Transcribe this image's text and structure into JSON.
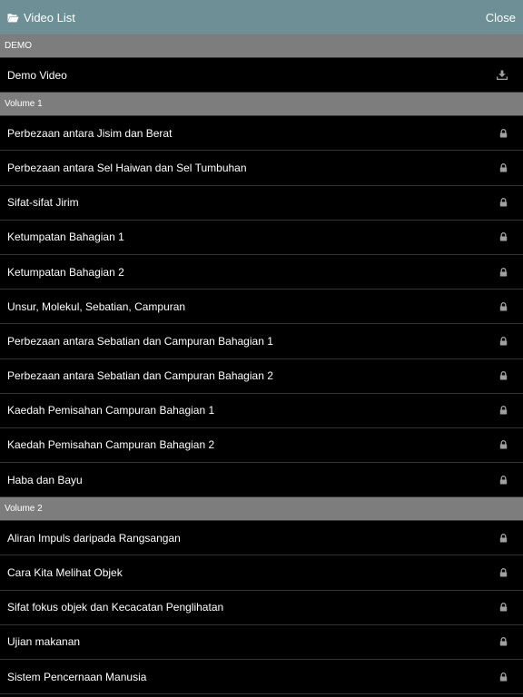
{
  "header": {
    "title": "Video List",
    "title_icon": "folder-open-icon",
    "close_label": "Close"
  },
  "sections": [
    {
      "label": "DEMO",
      "items": [
        {
          "label": "Demo Video",
          "icon": "download-icon"
        }
      ]
    },
    {
      "label": "Volume 1",
      "items": [
        {
          "label": "Perbezaan antara Jisim dan Berat",
          "icon": "lock-icon"
        },
        {
          "label": "Perbezaan antara Sel Haiwan dan Sel Tumbuhan",
          "icon": "lock-icon"
        },
        {
          "label": "Sifat-sifat Jirim",
          "icon": "lock-icon"
        },
        {
          "label": "Ketumpatan Bahagian 1",
          "icon": "lock-icon"
        },
        {
          "label": "Ketumpatan Bahagian 2",
          "icon": "lock-icon"
        },
        {
          "label": "Unsur, Molekul, Sebatian, Campuran",
          "icon": "lock-icon"
        },
        {
          "label": "Perbezaan antara Sebatian dan Campuran Bahagian 1",
          "icon": "lock-icon"
        },
        {
          "label": "Perbezaan antara Sebatian dan Campuran Bahagian 2",
          "icon": "lock-icon"
        },
        {
          "label": "Kaedah Pemisahan Campuran Bahagian 1",
          "icon": "lock-icon"
        },
        {
          "label": "Kaedah Pemisahan Campuran Bahagian 2",
          "icon": "lock-icon"
        },
        {
          "label": "Haba dan Bayu",
          "icon": "lock-icon"
        }
      ]
    },
    {
      "label": "Volume 2",
      "items": [
        {
          "label": "Aliran Impuls daripada Rangsangan",
          "icon": "lock-icon"
        },
        {
          "label": "Cara Kita Melihat Objek",
          "icon": "lock-icon"
        },
        {
          "label": "Sifat fokus objek dan Kecacatan Penglihatan",
          "icon": "lock-icon"
        },
        {
          "label": "Ujian makanan",
          "icon": "lock-icon"
        },
        {
          "label": "Sistem Pencernaan Manusia",
          "icon": "lock-icon"
        }
      ]
    }
  ],
  "colors": {
    "header_bg": "#6d8f95",
    "section_bg": "#7d7d7d",
    "row_bg": "#000000",
    "icon_color": "#a0a0a0"
  }
}
